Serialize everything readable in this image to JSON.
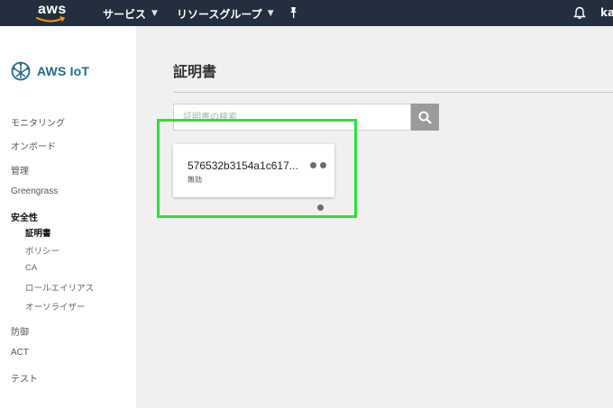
{
  "topnav": {
    "logo_text": "aws",
    "services_label": "サービス",
    "resource_groups_label": "リソースグループ",
    "user_label": "ka"
  },
  "sidebar": {
    "brand": "AWS IoT",
    "items": [
      {
        "label": "モニタリング"
      },
      {
        "label": "オンボード"
      },
      {
        "label": "管理"
      },
      {
        "label": "Greengrass"
      },
      {
        "label": "安全性"
      }
    ],
    "security_sub": [
      {
        "label": "証明書"
      },
      {
        "label": "ポリシー"
      },
      {
        "label": "CA"
      },
      {
        "label": "ロールエイリアス"
      },
      {
        "label": "オーソライザー"
      }
    ],
    "items_after": [
      {
        "label": "防御"
      },
      {
        "label": "ACT"
      },
      {
        "label": "テスト"
      }
    ]
  },
  "main": {
    "title": "証明書",
    "search_placeholder": "証明書の検索",
    "cert": {
      "id": "576532b3154a1c617...",
      "status": "無効"
    }
  },
  "colors": {
    "topnav_bg": "#232f3e",
    "brand_teal": "#1e6c8c",
    "highlight_green": "#2ee03a"
  }
}
